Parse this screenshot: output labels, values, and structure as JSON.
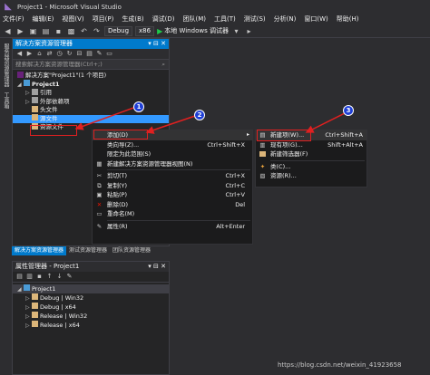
{
  "window": {
    "title": "Project1 - Microsoft Visual Studio"
  },
  "menu": [
    "文件(F)",
    "编辑(E)",
    "视图(V)",
    "项目(P)",
    "生成(B)",
    "调试(D)",
    "团队(M)",
    "工具(T)",
    "测试(S)",
    "分析(N)",
    "窗口(W)",
    "帮助(H)"
  ],
  "toolbar": {
    "config": "Debug",
    "platform": "x86",
    "run_label": "本地 Windows 调试器"
  },
  "left_tabs": [
    "服务器资源管理器",
    "工具箱"
  ],
  "solution_explorer": {
    "title": "解决方案资源管理器",
    "search_placeholder": "搜索解决方案资源管理器(Ctrl+;)",
    "tree": [
      {
        "label": "解决方案\"Project1\"(1 个项目)"
      },
      {
        "label": "Project1"
      },
      {
        "label": "引用"
      },
      {
        "label": "外部依赖项"
      },
      {
        "label": "头文件"
      },
      {
        "label": "源文件"
      },
      {
        "label": "资源文件"
      }
    ]
  },
  "bottom_tabs": [
    "解决方案资源管理器",
    "测试资源管理器",
    "团队资源管理器"
  ],
  "property_manager": {
    "title": "属性管理器 - Project1",
    "tree": [
      {
        "label": "Project1"
      },
      {
        "label": "Debug | Win32"
      },
      {
        "label": "Debug | x64"
      },
      {
        "label": "Release | Win32"
      },
      {
        "label": "Release | x64"
      }
    ]
  },
  "context_menu": [
    {
      "icon": "",
      "label": "添加(D)",
      "shortcut": "",
      "submenu": true
    },
    {
      "icon": "",
      "label": "类向导(Z)...",
      "shortcut": "Ctrl+Shift+X"
    },
    {
      "icon": "",
      "label": "限定为此范围(S)",
      "shortcut": ""
    },
    {
      "icon": "new-view-icon",
      "label": "新建解决方案资源管理器视图(N)",
      "shortcut": ""
    },
    {
      "icon": "cut-icon",
      "label": "剪切(T)",
      "shortcut": "Ctrl+X"
    },
    {
      "icon": "copy-icon",
      "label": "复制(Y)",
      "shortcut": "Ctrl+C"
    },
    {
      "icon": "paste-icon",
      "label": "粘贴(P)",
      "shortcut": "Ctrl+V"
    },
    {
      "icon": "delete-icon",
      "label": "删除(D)",
      "shortcut": "Del"
    },
    {
      "icon": "rename-icon",
      "label": "重命名(M)",
      "shortcut": ""
    },
    {
      "icon": "properties-icon",
      "label": "属性(R)",
      "shortcut": "Alt+Enter"
    }
  ],
  "add_submenu": [
    {
      "icon": "new-item-icon",
      "label": "新建项(W)...",
      "shortcut": "Ctrl+Shift+A"
    },
    {
      "icon": "existing-item-icon",
      "label": "现有项(G)...",
      "shortcut": "Shift+Alt+A"
    },
    {
      "icon": "new-filter-icon",
      "label": "新建筛选器(F)",
      "shortcut": ""
    },
    {
      "icon": "class-icon",
      "label": "类(C)...",
      "shortcut": ""
    },
    {
      "icon": "resource-icon",
      "label": "资源(R)...",
      "shortcut": ""
    }
  ],
  "callouts": [
    "1",
    "2",
    "3"
  ],
  "watermark": "https://blog.csdn.net/weixin_41923658",
  "colors": {
    "accent": "#007acc",
    "selection": "#3399ff",
    "highlight_box": "#e02020",
    "callout": "#1f3fd6"
  }
}
